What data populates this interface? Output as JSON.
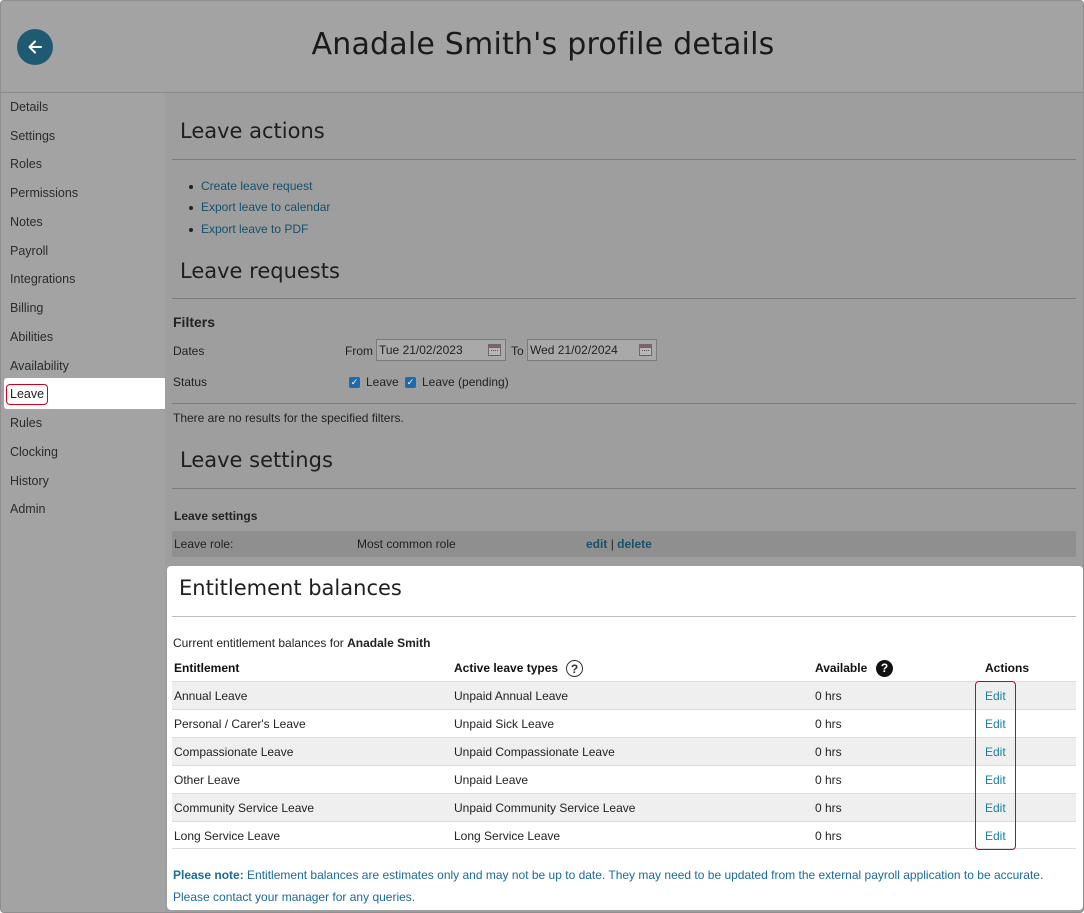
{
  "header": {
    "title": "Anadale Smith's profile details",
    "back_icon": "arrow-left-icon",
    "accent": "#1f5a73"
  },
  "sidebar": {
    "items": [
      "Details",
      "Settings",
      "Roles",
      "Permissions",
      "Notes",
      "Payroll",
      "Integrations",
      "Billing",
      "Abilities",
      "Availability",
      "Leave",
      "Rules",
      "Clocking",
      "History",
      "Admin"
    ],
    "active": "Leave"
  },
  "leave_actions": {
    "title": "Leave actions",
    "links": [
      "Create leave request",
      "Export leave to calendar",
      "Export leave to PDF"
    ]
  },
  "leave_requests": {
    "title": "Leave requests",
    "filters_label": "Filters",
    "dates_label": "Dates",
    "from_label": "From",
    "from_value": "Tue 21/02/2023",
    "to_label": "To",
    "to_value": "Wed 21/02/2024",
    "status_label": "Status",
    "status_options": [
      "Leave",
      "Leave (pending)"
    ],
    "no_results": "There are no results for the specified filters."
  },
  "leave_settings": {
    "title": "Leave settings",
    "table_heading": "Leave settings",
    "role_label": "Leave role:",
    "role_value": "Most common role",
    "edit_label": "edit",
    "separator": "|",
    "delete_label": "delete"
  },
  "entitlements": {
    "title": "Entitlement balances",
    "intro": "Current entitlement balances for",
    "person": "Anadale Smith",
    "columns": [
      "Entitlement",
      "Active leave types",
      "Available",
      "Actions"
    ],
    "rows": [
      {
        "entitlement": "Annual Leave",
        "type": "Unpaid Annual Leave",
        "available": "0 hrs",
        "action": "Edit"
      },
      {
        "entitlement": "Personal / Carer's Leave",
        "type": "Unpaid Sick Leave",
        "available": "0 hrs",
        "action": "Edit"
      },
      {
        "entitlement": "Compassionate Leave",
        "type": "Unpaid Compassionate Leave",
        "available": "0 hrs",
        "action": "Edit"
      },
      {
        "entitlement": "Other Leave",
        "type": "Unpaid Leave",
        "available": "0 hrs",
        "action": "Edit"
      },
      {
        "entitlement": "Community Service Leave",
        "type": "Unpaid Community Service Leave",
        "available": "0 hrs",
        "action": "Edit"
      },
      {
        "entitlement": "Long Service Leave",
        "type": "Long Service Leave",
        "available": "0 hrs",
        "action": "Edit"
      }
    ],
    "note_label": "Please note:",
    "note_text": "Entitlement balances are estimates only and may not be up to date. They may need to be updated from the external payroll application to be accurate. Please contact your manager for any queries."
  }
}
